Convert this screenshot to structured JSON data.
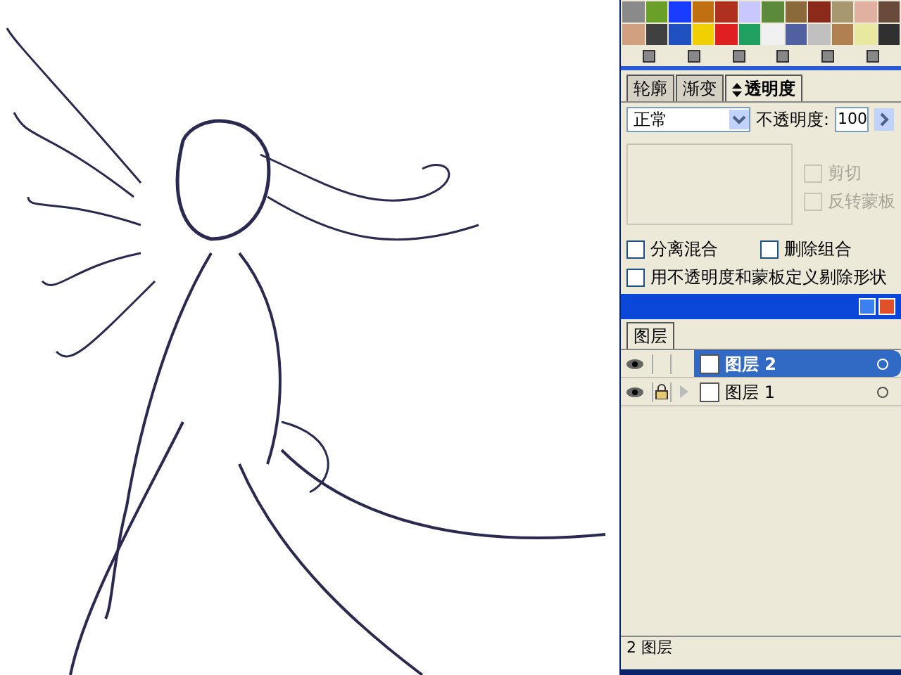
{
  "transparency_panel": {
    "tabs": [
      {
        "label": "轮廓",
        "selected": false
      },
      {
        "label": "渐变",
        "selected": false
      },
      {
        "label": "透明度",
        "selected": true
      }
    ],
    "blend_mode": "正常",
    "opacity_label": "不透明度:",
    "opacity_value": "100",
    "mask_options": [
      {
        "label": "剪切",
        "checked": false,
        "disabled": true
      },
      {
        "label": "反转蒙板",
        "checked": false,
        "disabled": true
      }
    ],
    "options": [
      {
        "label": "分离混合",
        "checked": false
      },
      {
        "label": "删除组合",
        "checked": false
      },
      {
        "label": "用不透明度和蒙板定义剔除形状",
        "checked": false
      }
    ]
  },
  "layers_panel": {
    "tab": "图层",
    "layers": [
      {
        "name": "图层 2",
        "selected": true,
        "locked": false,
        "expandable": false
      },
      {
        "name": "图层 1",
        "selected": false,
        "locked": true,
        "expandable": true
      }
    ],
    "status": "2 图层"
  }
}
